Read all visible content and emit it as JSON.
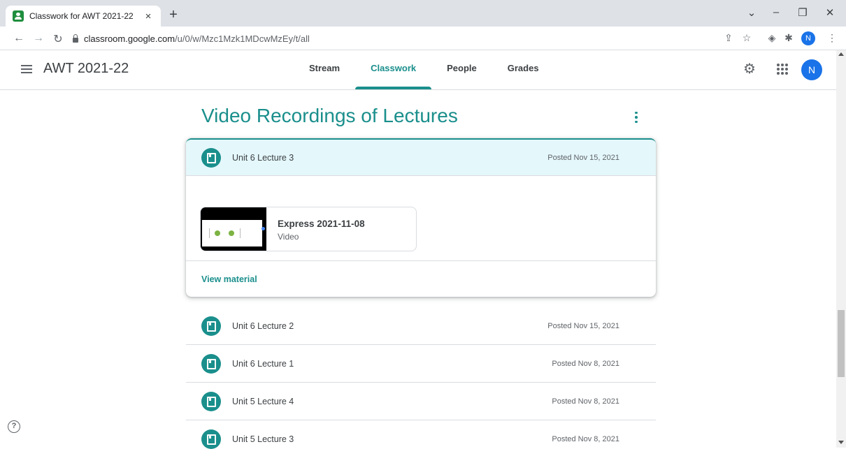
{
  "browser": {
    "tab_title": "Classwork for AWT 2021-22",
    "tab_close": "×",
    "new_tab": "+",
    "url_host": "classroom.google.com",
    "url_path": "/u/0/w/Mzc1Mzk1MDcwMzEy/t/all",
    "profile_initial": "N"
  },
  "header": {
    "class_name": "AWT 2021-22",
    "tabs": [
      {
        "label": "Stream"
      },
      {
        "label": "Classwork"
      },
      {
        "label": "People"
      },
      {
        "label": "Grades"
      }
    ],
    "active_tab": "Classwork",
    "avatar_initial": "N"
  },
  "topic": {
    "title": "Video Recordings of Lectures",
    "expanded_item": {
      "title": "Unit 6 Lecture 3",
      "date": "Posted Nov 15, 2021",
      "attachment": {
        "title": "Express 2021-11-08",
        "type": "Video"
      },
      "view_label": "View material"
    },
    "items": [
      {
        "title": "Unit 6 Lecture 2",
        "date": "Posted Nov 15, 2021"
      },
      {
        "title": "Unit 6 Lecture 1",
        "date": "Posted Nov 8, 2021"
      },
      {
        "title": "Unit 5 Lecture 4",
        "date": "Posted Nov 8, 2021"
      },
      {
        "title": "Unit 5 Lecture 3",
        "date": "Posted Nov 8, 2021"
      }
    ]
  },
  "help_label": "?",
  "colors": {
    "accent": "#1a8f8c",
    "highlight": "#e4f7fb",
    "avatar": "#1a73e8"
  }
}
